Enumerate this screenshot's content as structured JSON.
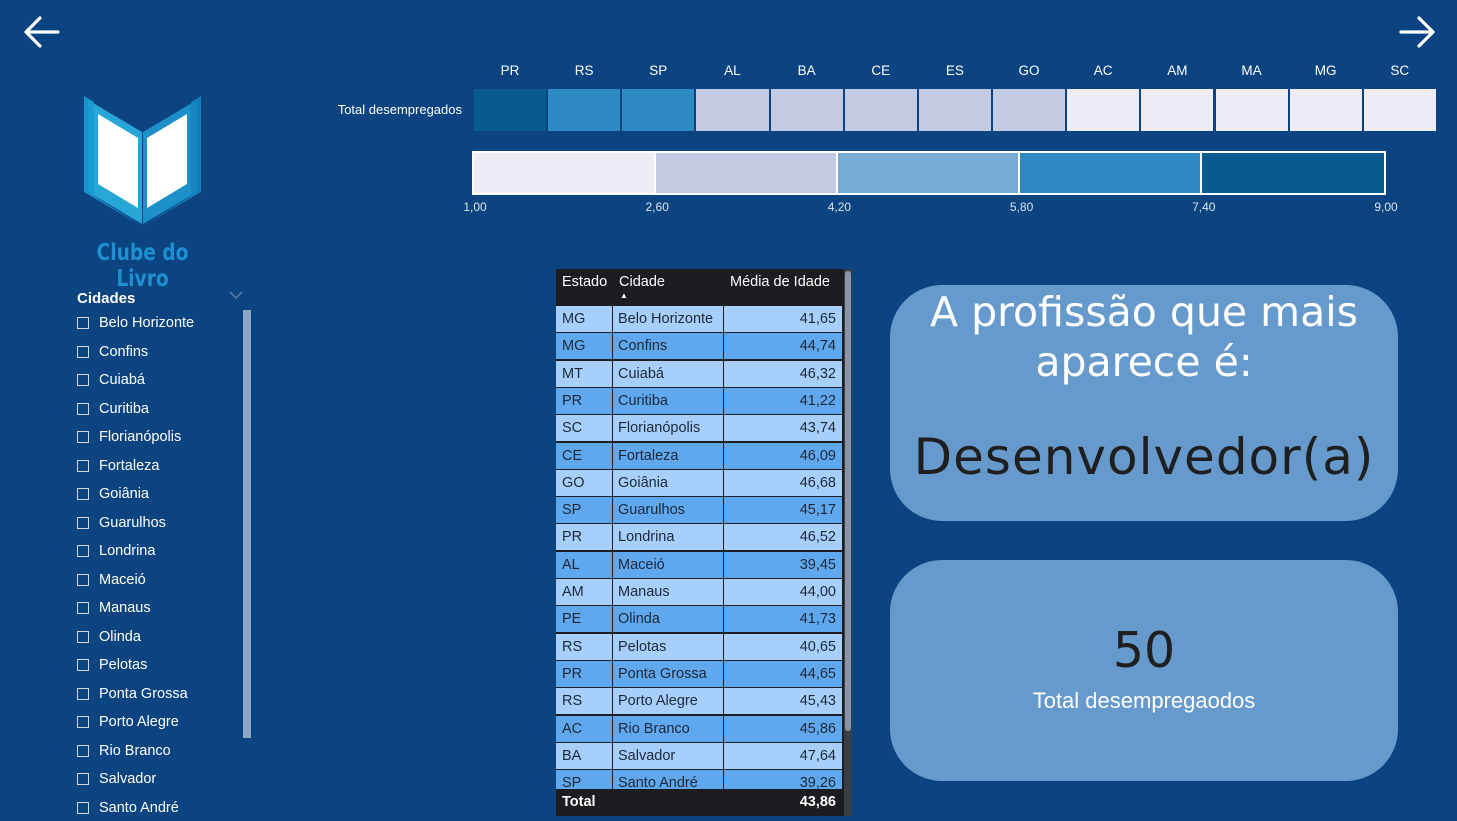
{
  "nav": {
    "back_icon": "arrow-left-icon",
    "forward_icon": "arrow-right-icon"
  },
  "brand": {
    "name": "Clube do Livro",
    "logo_icon": "open-book-icon"
  },
  "slicer": {
    "title": "Cidades",
    "items": [
      "Belo Horizonte",
      "Confins",
      "Cuiabá",
      "Curitiba",
      "Florianópolis",
      "Fortaleza",
      "Goiânia",
      "Guarulhos",
      "Londrina",
      "Maceió",
      "Manaus",
      "Olinda",
      "Pelotas",
      "Ponta Grossa",
      "Porto Alegre",
      "Rio Branco",
      "Salvador",
      "Santo André"
    ]
  },
  "heatmap": {
    "row_label": "Total desempregados",
    "states": [
      "PR",
      "RS",
      "SP",
      "AL",
      "BA",
      "CE",
      "ES",
      "GO",
      "AC",
      "AM",
      "MA",
      "MG",
      "SC"
    ],
    "colors": [
      "#0a5a92",
      "#2d8ac2",
      "#2d8ac2",
      "#c3cbe2",
      "#c3cbe2",
      "#c3cbe2",
      "#c3cbe2",
      "#c3cbe2",
      "#efecf5",
      "#efecf5",
      "#efecf5",
      "#efecf5",
      "#efecf5"
    ]
  },
  "legend": {
    "ticks": [
      "1,00",
      "2,60",
      "4,20",
      "5,80",
      "7,40",
      "9,00"
    ],
    "colors": [
      "#efecf5",
      "#c3cbe2",
      "#78abd3",
      "#2d8ac2",
      "#0a5a92"
    ]
  },
  "table": {
    "headers": {
      "estado": "Estado",
      "cidade": "Cidade",
      "media": "Média de Idade"
    },
    "row_colors": [
      "#a6d0fb",
      "#5fa8ee"
    ],
    "rows": [
      {
        "estado": "MG",
        "cidade": "Belo Horizonte",
        "media": "41,65"
      },
      {
        "estado": "MG",
        "cidade": "Confins",
        "media": "44,74"
      },
      {
        "estado": "MT",
        "cidade": "Cuiabá",
        "media": "46,32"
      },
      {
        "estado": "PR",
        "cidade": "Curitiba",
        "media": "41,22"
      },
      {
        "estado": "SC",
        "cidade": "Florianópolis",
        "media": "43,74"
      },
      {
        "estado": "CE",
        "cidade": "Fortaleza",
        "media": "46,09"
      },
      {
        "estado": "GO",
        "cidade": "Goiânia",
        "media": "46,68"
      },
      {
        "estado": "SP",
        "cidade": "Guarulhos",
        "media": "45,17"
      },
      {
        "estado": "PR",
        "cidade": "Londrina",
        "media": "46,52"
      },
      {
        "estado": "AL",
        "cidade": "Maceió",
        "media": "39,45"
      },
      {
        "estado": "AM",
        "cidade": "Manaus",
        "media": "44,00"
      },
      {
        "estado": "PE",
        "cidade": "Olinda",
        "media": "41,73"
      },
      {
        "estado": "RS",
        "cidade": "Pelotas",
        "media": "40,65"
      },
      {
        "estado": "PR",
        "cidade": "Ponta Grossa",
        "media": "44,65"
      },
      {
        "estado": "RS",
        "cidade": "Porto Alegre",
        "media": "45,43"
      },
      {
        "estado": "AC",
        "cidade": "Rio Branco",
        "media": "45,86"
      },
      {
        "estado": "BA",
        "cidade": "Salvador",
        "media": "47,64"
      },
      {
        "estado": "SP",
        "cidade": "Santo André",
        "media": "39,26"
      }
    ],
    "total_label": "Total",
    "total_value": "43,86"
  },
  "card_profession": {
    "title_line1": "A profissão que mais",
    "title_line2": "aparece é:",
    "value": "Desenvolvedor(a)"
  },
  "card_total": {
    "value": "50",
    "label": "Total desempregaodos"
  }
}
